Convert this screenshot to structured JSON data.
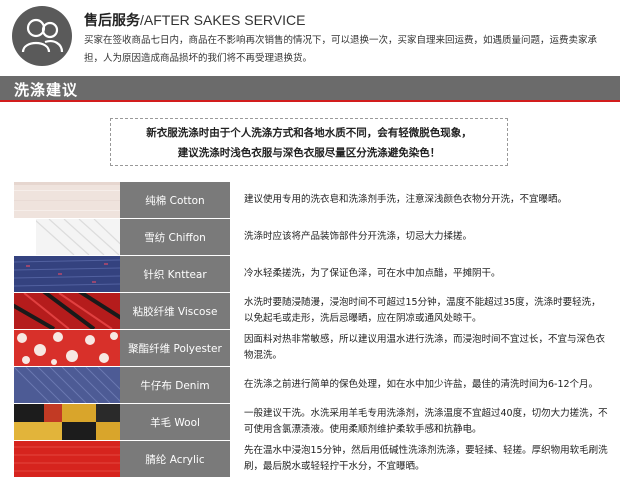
{
  "after_sales": {
    "title_cn": "售后服务",
    "title_en": "/AFTER SAKES SERVICE",
    "body": "买家在签收商品七日内，商品在不影响再次销售的情况下，可以退换一次，买家自理来回运费，如遇质量问题，运费卖家承担，人为原因造成商品损坏的我们将不再受理退换货。",
    "icon": "users-icon"
  },
  "section": {
    "title": "洗涤建议"
  },
  "notice": {
    "line1": "新衣服洗涤时由于个人洗涤方式和各地水质不同，会有轻微脱色现象，",
    "line2": "建议洗涤时浅色衣服与深色衣服尽量区分洗涤避免染色！"
  },
  "fabrics": [
    {
      "label": "纯棉 Cotton",
      "desc": "建议使用专用的洗衣皂和洗涤剂手洗，注意深浅颜色衣物分开洗，不宜曝晒。",
      "color": "#efe4df"
    },
    {
      "label": "雪纺 Chiffon",
      "desc": "洗涤时应该将产品装饰部件分开洗涤，切忌大力揉搓。",
      "color": "#f3f3f3"
    },
    {
      "label": "针织 Knttear",
      "desc": "冷水轻柔搓洗，为了保证色泽，可在水中加点醋，平摊阴干。",
      "color": "#3b4a8a"
    },
    {
      "label": "粘胶纤维 Viscose",
      "desc": "水洗时要随浸随漫，浸泡时间不可超过15分钟，温度不能超过35度，洗涤时要轻洗，以免起毛或走形，洗后忌曝晒，应在阴凉或通风处晾干。",
      "color": "#b81d1d"
    },
    {
      "label": "聚酯纤维 Polyester",
      "desc": "因面料对热非常敏感，所以建议用温水进行洗涤，而浸泡时间不宜过长，不宜与深色衣物混洗。",
      "color": "#d8322a"
    },
    {
      "label": "牛仔布 Denim",
      "desc": "在洗涤之前进行简单的保色处理，如在水中加少许盐，最佳的清洗时间为6-12个月。",
      "color": "#4f5f9a"
    },
    {
      "label": "羊毛 Wool",
      "desc": "一般建议干洗。水洗采用羊毛专用洗涤剂，洗涤温度不宜超过40度，切勿大力搓洗，不可使用含氯漂渍液。使用柔顺剂维护柔软手感和抗静电。",
      "color": "#d9a52b"
    },
    {
      "label": "腈纶 Acrylic",
      "desc": "先在温水中浸泡15分钟，然后用低碱性洗涤剂洗涤，要轻揉、轻搓。厚织物用软毛刷洗刷，最后脱水或轻轻拧干水分，不宜曝晒。",
      "color": "#d8251f"
    }
  ]
}
